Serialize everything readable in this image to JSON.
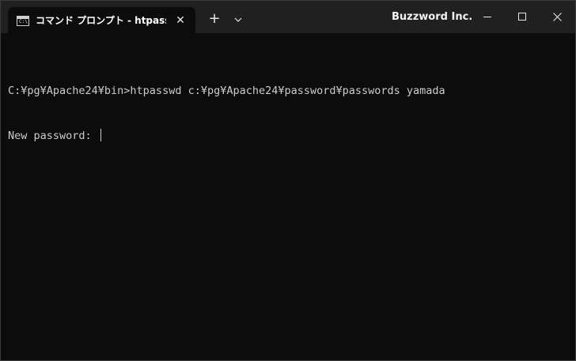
{
  "tab": {
    "title": "コマンド プロンプト - htpasswd  c:\\",
    "icon": "command-prompt-icon",
    "icon_text": "C:\\",
    "close_glyph": "✕"
  },
  "titlebar": {
    "new_tab_glyph": "+",
    "brand": "Buzzword Inc."
  },
  "terminal": {
    "lines": [
      "C:¥pg¥Apache24¥bin>htpasswd c:¥pg¥Apache24¥password¥passwords yamada",
      "New password: "
    ]
  },
  "colors": {
    "background": "#0c0c0c",
    "titlebar": "#202020",
    "text": "#cccccc"
  }
}
